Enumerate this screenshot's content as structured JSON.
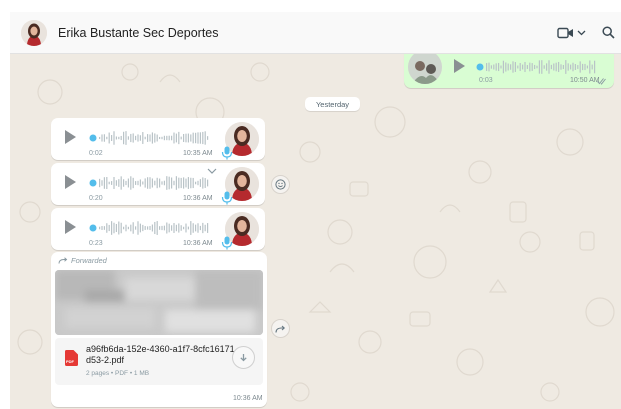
{
  "header": {
    "contact_name": "Erika Bustante Sec Deportes"
  },
  "date_separator": "Yesterday",
  "outgoing_voice": {
    "duration": "0:03",
    "time": "10:50 AM",
    "status": "read"
  },
  "voice_messages": [
    {
      "duration": "0:02",
      "time": "10:35 AM"
    },
    {
      "duration": "0:20",
      "time": "10:36 AM"
    },
    {
      "duration": "0:23",
      "time": "10:36 AM"
    }
  ],
  "forwarded": {
    "label": "Forwarded",
    "file_name": "a96fb6da-152e-4360-a1f7-8cfc16171d53-2.pdf",
    "file_meta": "2 pages • PDF • 1 MB",
    "pdf_badge": "PDF",
    "time": "10:36 AM"
  },
  "colors": {
    "wallpaper": "#efeae2",
    "outgoing_bubble": "#d9fdd3",
    "waveform_dot": "#53bdeb",
    "read_check": "#53bdeb",
    "pdf_red": "#e53935"
  },
  "icons": [
    "video-call-icon",
    "chevron-down-icon",
    "search-icon",
    "play-icon",
    "microphone-icon",
    "emoji-icon",
    "forward-icon",
    "pdf-icon",
    "download-icon",
    "read-check-icon"
  ]
}
